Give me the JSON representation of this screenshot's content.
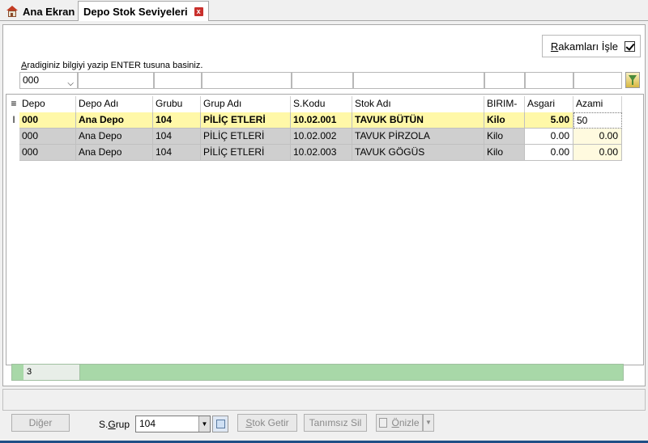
{
  "tabs": [
    {
      "label": "Ana Ekran"
    },
    {
      "label": "Depo Stok Seviyeleri",
      "close": "x"
    }
  ],
  "options": {
    "rakamlari_isle_label_u": "R",
    "rakamlari_isle_label_rest": "akamları İşle",
    "checked": true
  },
  "search": {
    "hint_u": "A",
    "hint_rest": "radiginiz bilgiyi yazip ENTER tusuna basiniz.",
    "depo_value": "000"
  },
  "grid": {
    "columns": [
      "Depo",
      "Depo Adı",
      "Grubu",
      "Grup Adı",
      "S.Kodu",
      "Stok Adı",
      "BIRIM-",
      "Asgari",
      "Azami"
    ],
    "rows": [
      {
        "depo": "000",
        "depo_adi": "Ana Depo",
        "grubu": "104",
        "grup_adi": "PİLİÇ ETLERİ",
        "s_kodu": "10.02.001",
        "stok_adi": "TAVUK BÜTÜN",
        "birim": "Kilo",
        "asgari": "5.00",
        "azami": "50"
      },
      {
        "depo": "000",
        "depo_adi": "Ana Depo",
        "grubu": "104",
        "grup_adi": "PİLİÇ ETLERİ",
        "s_kodu": "10.02.002",
        "stok_adi": "TAVUK PİRZOLA",
        "birim": "Kilo",
        "asgari": "0.00",
        "azami": "0.00"
      },
      {
        "depo": "000",
        "depo_adi": "Ana Depo",
        "grubu": "104",
        "grup_adi": "PİLİÇ ETLERİ",
        "s_kodu": "10.02.003",
        "stok_adi": "TAVUK GÖGÜS",
        "birim": "Kilo",
        "asgari": "0.00",
        "azami": "0.00"
      }
    ],
    "row_count": "3",
    "row_indicator": "I"
  },
  "bottom": {
    "diger_u": "Di",
    "diger_rest": "ğer",
    "sgrup_pre": "S.",
    "sgrup_u": "G",
    "sgrup_rest": "rup",
    "sgrup_value": "104",
    "stok_getir_u": "S",
    "stok_getir_rest": "tok Getir",
    "tanimsiz_sil": "Tanımsız Sil",
    "onizle_u": "Ö",
    "onizle_rest": "nizle"
  },
  "colors": {
    "selected_row": "#fff8a8",
    "gray_row": "#cfcfcf",
    "summary": "#a8d8a8",
    "accent": "#1f4f86"
  }
}
